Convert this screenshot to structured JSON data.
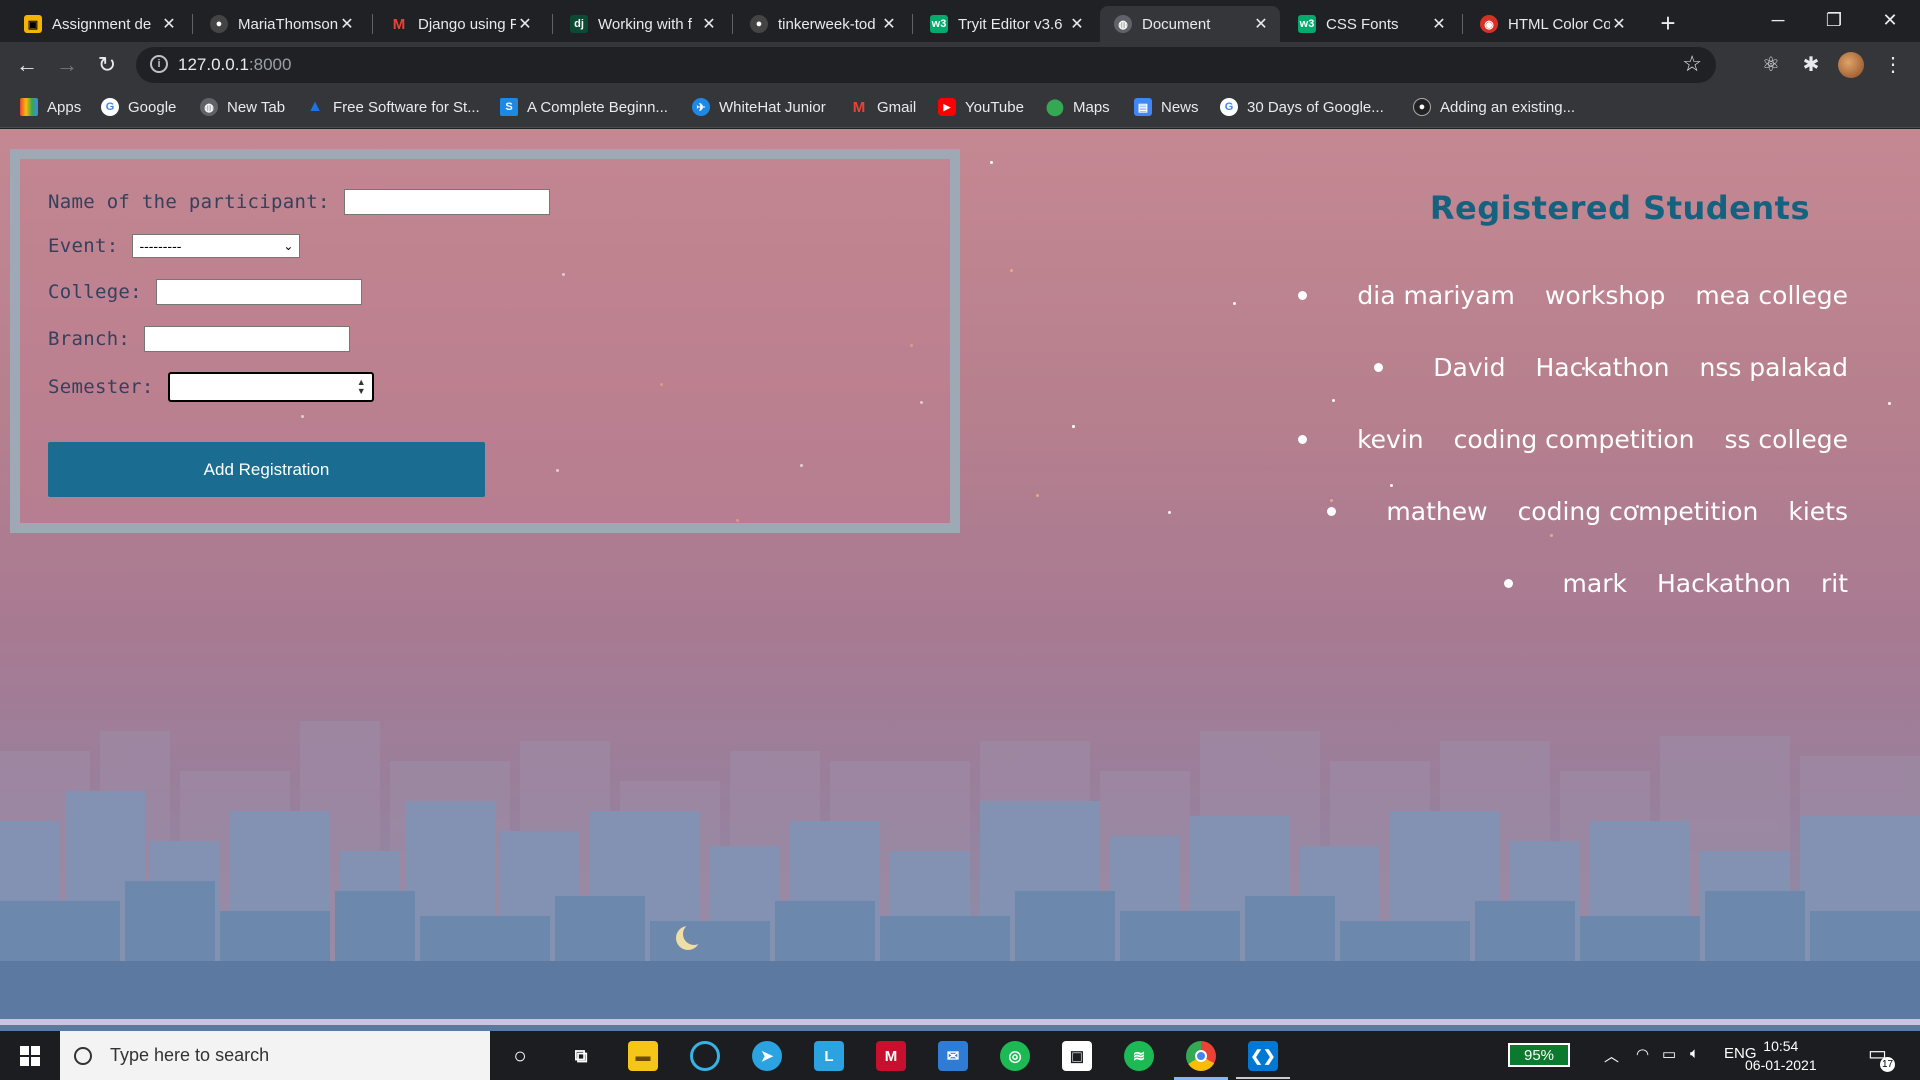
{
  "browser": {
    "tabs": [
      {
        "title": "Assignment de",
        "favicon_color": "#f4b400",
        "active": false
      },
      {
        "title": "MariaThomson",
        "favicon_color": "#444444",
        "active": false
      },
      {
        "title": "Django using P",
        "favicon_color": "#ea4335",
        "active": false
      },
      {
        "title": "Working with f",
        "favicon_color": "#0c4b33",
        "active": false
      },
      {
        "title": "tinkerweek-tod",
        "favicon_color": "#444444",
        "active": false
      },
      {
        "title": "Tryit Editor v3.6",
        "favicon_color": "#04aa6d",
        "active": false
      },
      {
        "title": "Document",
        "favicon_color": "#5f6368",
        "active": true
      },
      {
        "title": "CSS Fonts",
        "favicon_color": "#04aa6d",
        "active": false
      },
      {
        "title": "HTML Color Co",
        "favicon_color": "#d93025",
        "active": false
      }
    ],
    "favicon_letters": [
      "",
      "",
      "M",
      "dj",
      "",
      "w3",
      "",
      "w3",
      ""
    ],
    "url_host": "127.0.0.1",
    "url_port": ":8000",
    "bookmarks": [
      {
        "label": "Apps",
        "icon_color": "#f4b400"
      },
      {
        "label": "Google",
        "icon_color": "#4285f4"
      },
      {
        "label": "New Tab",
        "icon_color": "#5f6368"
      },
      {
        "label": "Free Software for St...",
        "icon_color": "#1a73e8"
      },
      {
        "label": "A Complete Beginn...",
        "icon_color": "#1e88e5"
      },
      {
        "label": "WhiteHat Junior",
        "icon_color": "#ff6d00"
      },
      {
        "label": "Gmail",
        "icon_color": "#ea4335"
      },
      {
        "label": "YouTube",
        "icon_color": "#ff0000"
      },
      {
        "label": "Maps",
        "icon_color": "#34a853"
      },
      {
        "label": "News",
        "icon_color": "#4285f4"
      },
      {
        "label": "30 Days of Google...",
        "icon_color": "#4285f4"
      },
      {
        "label": "Adding an existing...",
        "icon_color": "#444444"
      }
    ]
  },
  "form": {
    "name_label": "Name of the participant:",
    "event_label": "Event:",
    "event_selected": "---------",
    "college_label": "College:",
    "branch_label": "Branch:",
    "semester_label": "Semester:",
    "submit_label": "Add Registration"
  },
  "registered": {
    "title": "Registered Students",
    "students": [
      {
        "name": "dia mariyam",
        "event": "workshop",
        "college": "mea college"
      },
      {
        "name": "David",
        "event": "Hackathon",
        "college": "nss palakad"
      },
      {
        "name": "kevin",
        "event": "coding competition",
        "college": "ss college"
      },
      {
        "name": "mathew",
        "event": "coding competition",
        "college": "kiets"
      },
      {
        "name": "mark",
        "event": "Hackathon",
        "college": "rit"
      }
    ]
  },
  "taskbar": {
    "search_placeholder": "Type here to search",
    "battery": "95%",
    "language": "ENG",
    "time": "10:54",
    "date": "06-01-2021",
    "notification_count": "17"
  },
  "colors": {
    "accent_button": "#1a6c91",
    "title_color": "#14627f",
    "label_color": "#34415e",
    "card_border": "#9fa9b5"
  }
}
